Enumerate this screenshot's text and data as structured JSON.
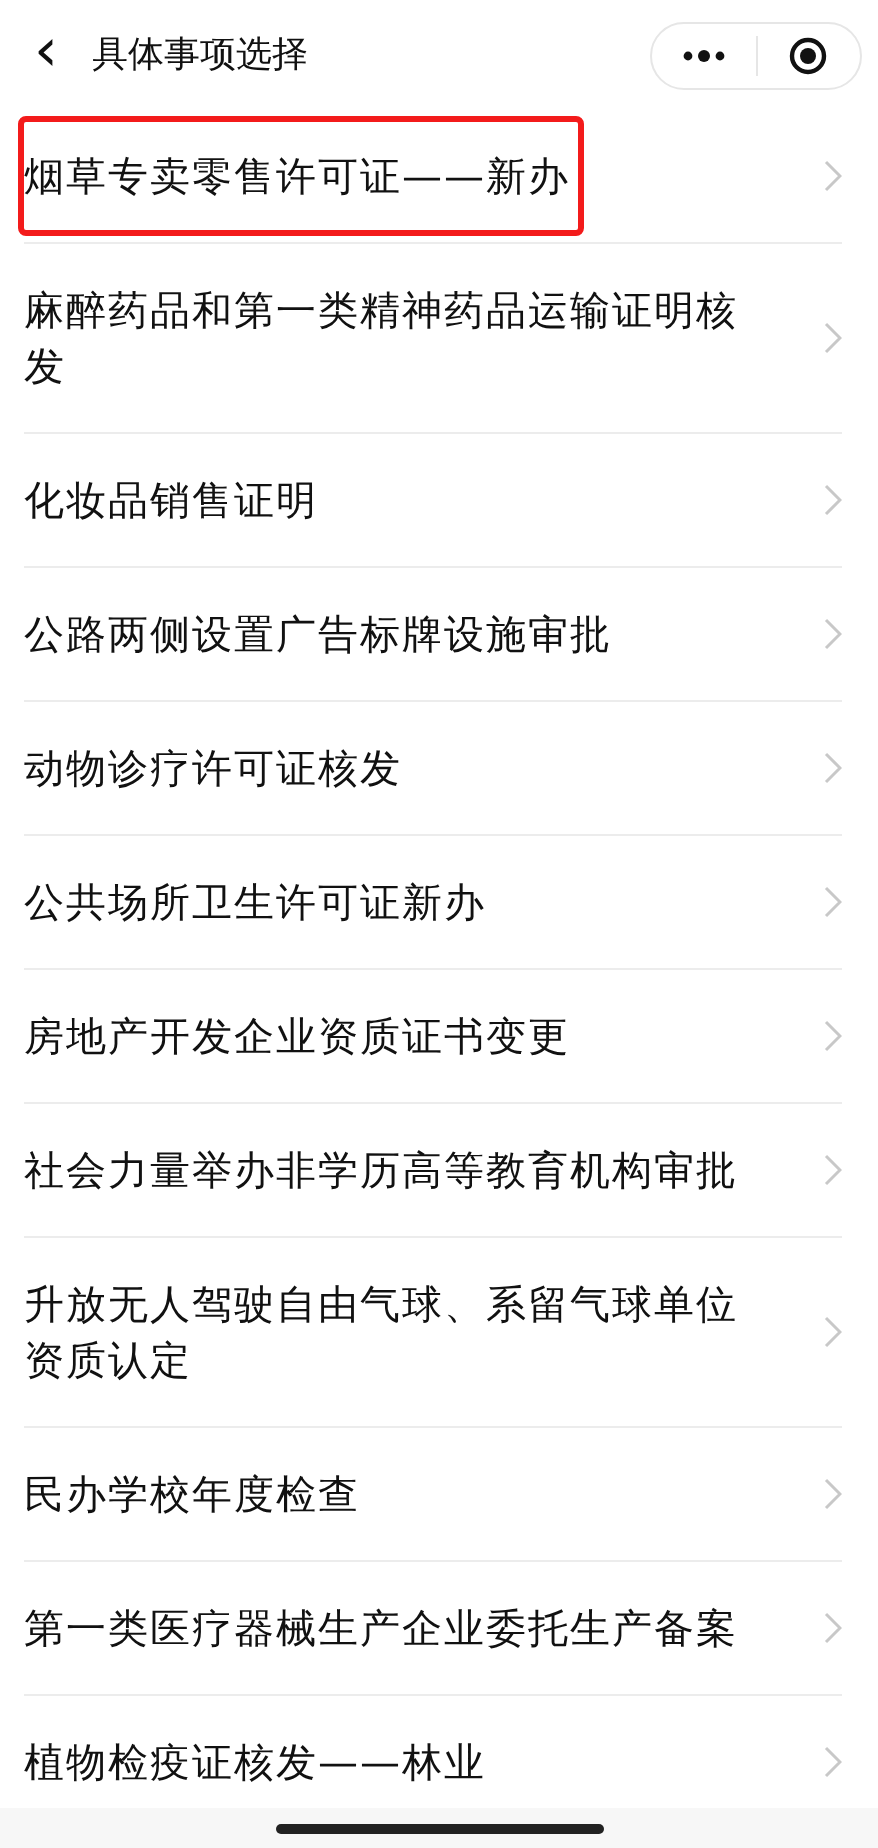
{
  "header": {
    "back_icon": "‹",
    "title": "具体事项选择"
  },
  "items": [
    {
      "label": "烟草专卖零售许可证——新办",
      "highlighted": true
    },
    {
      "label": "麻醉药品和第一类精神药品运输证明核发",
      "highlighted": false
    },
    {
      "label": "化妆品销售证明",
      "highlighted": false
    },
    {
      "label": "公路两侧设置广告标牌设施审批",
      "highlighted": false
    },
    {
      "label": "动物诊疗许可证核发",
      "highlighted": false
    },
    {
      "label": "公共场所卫生许可证新办",
      "highlighted": false
    },
    {
      "label": "房地产开发企业资质证书变更",
      "highlighted": false
    },
    {
      "label": "社会力量举办非学历高等教育机构审批",
      "highlighted": false
    },
    {
      "label": "升放无人驾驶自由气球、系留气球单位资质认定",
      "highlighted": false
    },
    {
      "label": "民办学校年度检查",
      "highlighted": false
    },
    {
      "label": "第一类医疗器械生产企业委托生产备案",
      "highlighted": false
    },
    {
      "label": "植物检疫证核发——林业",
      "highlighted": false
    }
  ]
}
